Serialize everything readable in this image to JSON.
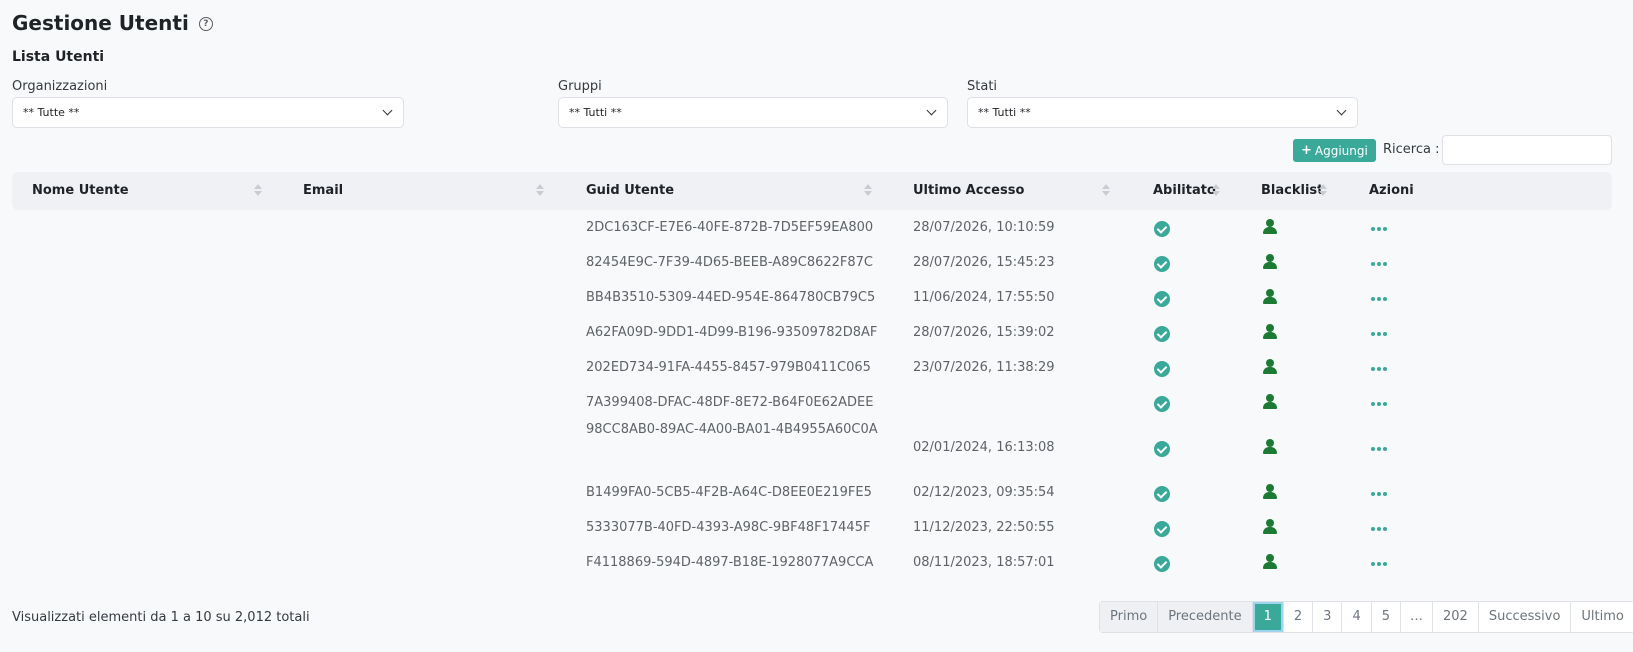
{
  "header": {
    "title": "Gestione Utenti",
    "help_icon": "question-circle-icon",
    "subtitle": "Lista Utenti"
  },
  "filters": {
    "organizations": {
      "label": "Organizzazioni",
      "value": "** Tutte **"
    },
    "groups": {
      "label": "Gruppi",
      "value": "** Tutti **"
    },
    "states": {
      "label": "Stati",
      "value": "** Tutti **"
    }
  },
  "toolbar": {
    "add_label": "Aggiungi",
    "search_label": "Ricerca :",
    "search_value": ""
  },
  "table": {
    "columns": [
      "Nome Utente",
      "Email",
      "Guid Utente",
      "Ultimo Accesso",
      "Abilitato",
      "Blacklist",
      "Azioni"
    ],
    "rows": [
      {
        "name": "",
        "email": "",
        "guid": "2DC163CF-E7E6-40FE-872B-7D5EF59EA800",
        "last_access": "28/07/2026, 10:10:59",
        "enabled": true
      },
      {
        "name": "",
        "email": "",
        "guid": "82454E9C-7F39-4D65-BEEB-A89C8622F87C",
        "last_access": "28/07/2026, 15:45:23",
        "enabled": true
      },
      {
        "name": "",
        "email": "",
        "guid": "BB4B3510-5309-44ED-954E-864780CB79C5",
        "last_access": "11/06/2024, 17:55:50",
        "enabled": true
      },
      {
        "name": "",
        "email": "",
        "guid": "A62FA09D-9DD1-4D99-B196-93509782D8AF",
        "last_access": "28/07/2026, 15:39:02",
        "enabled": true
      },
      {
        "name": "",
        "email": "",
        "guid": "202ED734-91FA-4455-8457-979B0411C065",
        "last_access": "23/07/2026, 11:38:29",
        "enabled": true
      },
      {
        "name": "",
        "email": "",
        "guid": "7A399408-DFAC-48DF-8E72-B64F0E62ADEE",
        "last_access": "",
        "enabled": true
      },
      {
        "name": "",
        "email": "",
        "guid": "98CC8AB0-89AC-4A00-BA01-4B4955A60C0A",
        "last_access": "02/01/2024, 16:13:08",
        "enabled": true
      },
      {
        "name": "",
        "email": "",
        "guid": "B1499FA0-5CB5-4F2B-A64C-D8EE0E219FE5",
        "last_access": "02/12/2023, 09:35:54",
        "enabled": true
      },
      {
        "name": "",
        "email": "",
        "guid": "5333077B-40FD-4393-A98C-9BF48F17445F",
        "last_access": "11/12/2023, 22:50:55",
        "enabled": true
      },
      {
        "name": "",
        "email": "",
        "guid": "F4118869-594D-4897-B18E-1928077A9CCA",
        "last_access": "08/11/2023, 18:57:01",
        "enabled": true
      }
    ]
  },
  "footer": {
    "info": "Visualizzati elementi da 1 a 10 su 2,012 totali"
  },
  "pagination": {
    "first": "Primo",
    "previous": "Precedente",
    "pages": [
      "1",
      "2",
      "3",
      "4",
      "5",
      "…",
      "202"
    ],
    "current": "1",
    "next": "Successivo",
    "last": "Ultimo"
  },
  "colors": {
    "accent": "#3aa99a",
    "blacklist_icon": "#1c7a34"
  }
}
